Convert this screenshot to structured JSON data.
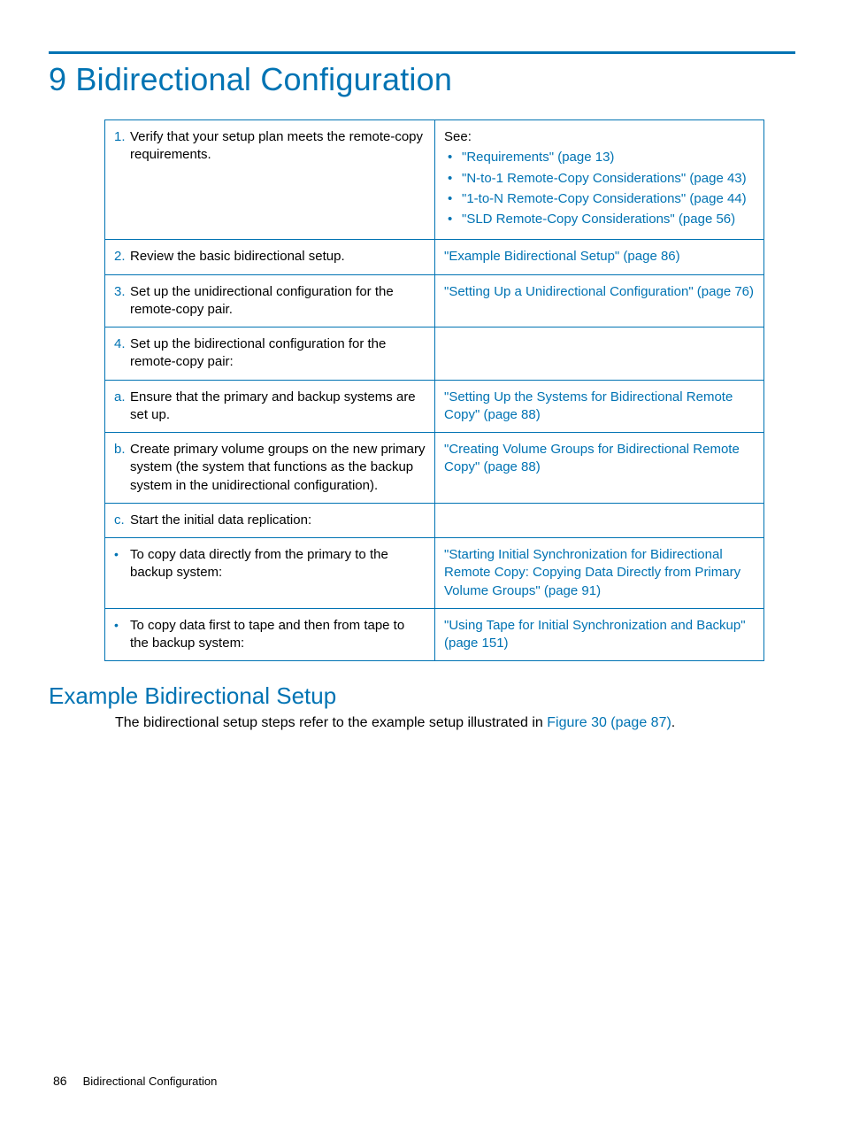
{
  "chapterTitle": "9 Bidirectional Configuration",
  "rows": [
    {
      "marker": "1.",
      "markerClass": "marker",
      "text": "Verify that your setup plan meets the remote-copy requirements.",
      "rightLead": "See:",
      "rightList": [
        "\"Requirements\" (page 13)",
        "\"N-to-1 Remote-Copy Considerations\" (page 43)",
        "\"1-to-N Remote-Copy Considerations\" (page 44)",
        "\"SLD Remote-Copy Considerations\" (page 56)"
      ]
    },
    {
      "marker": "2.",
      "markerClass": "marker",
      "text": "Review the basic bidirectional setup.",
      "rightLink": "\"Example Bidirectional Setup\" (page 86)"
    },
    {
      "marker": "3.",
      "markerClass": "marker",
      "text": "Set up the unidirectional configuration for the remote-copy pair.",
      "rightLink": "\"Setting Up a Unidirectional Configuration\" (page 76)"
    },
    {
      "marker": "4.",
      "markerClass": "marker",
      "text": "Set up the bidirectional configuration for the remote-copy pair:",
      "rightLink": ""
    },
    {
      "marker": "a.",
      "markerClass": "marker",
      "text": "Ensure that the primary and backup systems are set up.",
      "rightLink": "\"Setting Up the Systems for Bidirectional Remote Copy\" (page 88)"
    },
    {
      "marker": "b.",
      "markerClass": "marker",
      "text": "Create primary volume groups on the new primary system (the system that functions as the backup system in the unidirectional configuration).",
      "rightLink": "\"Creating Volume Groups for Bidirectional Remote Copy\" (page 88)"
    },
    {
      "marker": "c.",
      "markerClass": "marker",
      "text": "Start the initial data replication:",
      "rightLink": ""
    },
    {
      "marker": "•",
      "markerClass": "marker-dot",
      "text": "To copy data directly from the primary to the backup system:",
      "rightLink": "\"Starting Initial Synchronization for Bidirectional Remote Copy: Copying Data Directly from Primary Volume Groups\" (page 91)"
    },
    {
      "marker": "•",
      "markerClass": "marker-dot",
      "text": "To copy data first to tape and then from tape to the backup system:",
      "rightLink": "\"Using Tape for Initial Synchronization and Backup\" (page 151)"
    }
  ],
  "sectionTitle": "Example Bidirectional Setup",
  "introPrefix": "The bidirectional setup steps refer to the example setup illustrated in ",
  "introLink": "Figure 30 (page 87)",
  "introSuffix": ".",
  "footerPage": "86",
  "footerTitle": "Bidirectional Configuration"
}
